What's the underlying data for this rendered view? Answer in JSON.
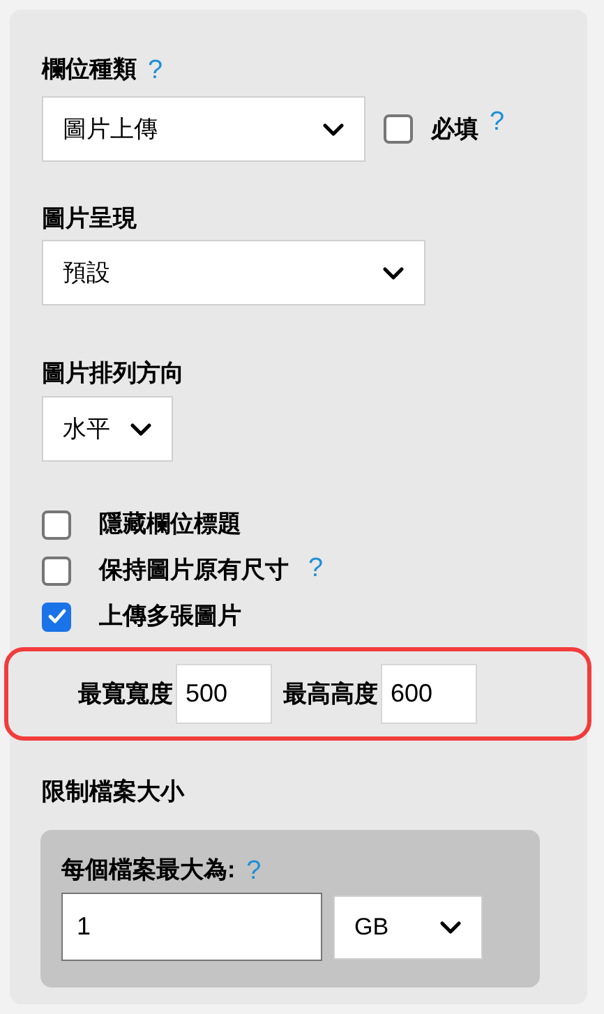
{
  "field_type": {
    "label": "欄位種類",
    "help": "?",
    "select": {
      "value": "圖片上傳"
    },
    "required": {
      "label": "必填",
      "checked": false,
      "help": "?"
    }
  },
  "image_display": {
    "label": "圖片呈現",
    "select": {
      "value": "預設"
    }
  },
  "image_direction": {
    "label": "圖片排列方向",
    "select": {
      "value": "水平"
    }
  },
  "options": [
    {
      "label": "隱藏欄位標題",
      "checked": false
    },
    {
      "label": "保持圖片原有尺寸",
      "checked": false,
      "help": "?"
    },
    {
      "label": "上傳多張圖片",
      "checked": true
    }
  ],
  "max_size": {
    "highlighted": true,
    "fields": [
      {
        "label": "最寬寬度",
        "value": "500"
      },
      {
        "label": "最高高度",
        "value": "600"
      }
    ]
  },
  "file_limit": {
    "label": "限制檔案大小",
    "per_file": {
      "label": "每個檔案最大為:",
      "help": "?",
      "value": "1",
      "unit": "GB"
    }
  }
}
